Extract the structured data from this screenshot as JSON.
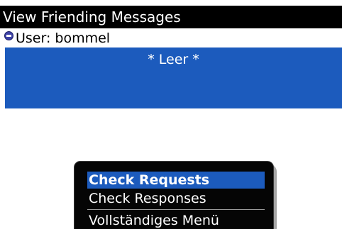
{
  "app": {
    "title": "View Friending Messages"
  },
  "user": {
    "label": "User: bommel",
    "icon": "user-status-icon"
  },
  "list": {
    "empty_text": "* Leer *"
  },
  "menu": {
    "items": [
      {
        "label": "Check Requests",
        "selected": true
      },
      {
        "label": "Check Responses",
        "selected": false
      },
      {
        "label": "Vollständiges Menü",
        "selected": false
      }
    ]
  },
  "colors": {
    "title_bg": "#000000",
    "selection": "#1c5bbd",
    "menu_bg": "#050505"
  }
}
